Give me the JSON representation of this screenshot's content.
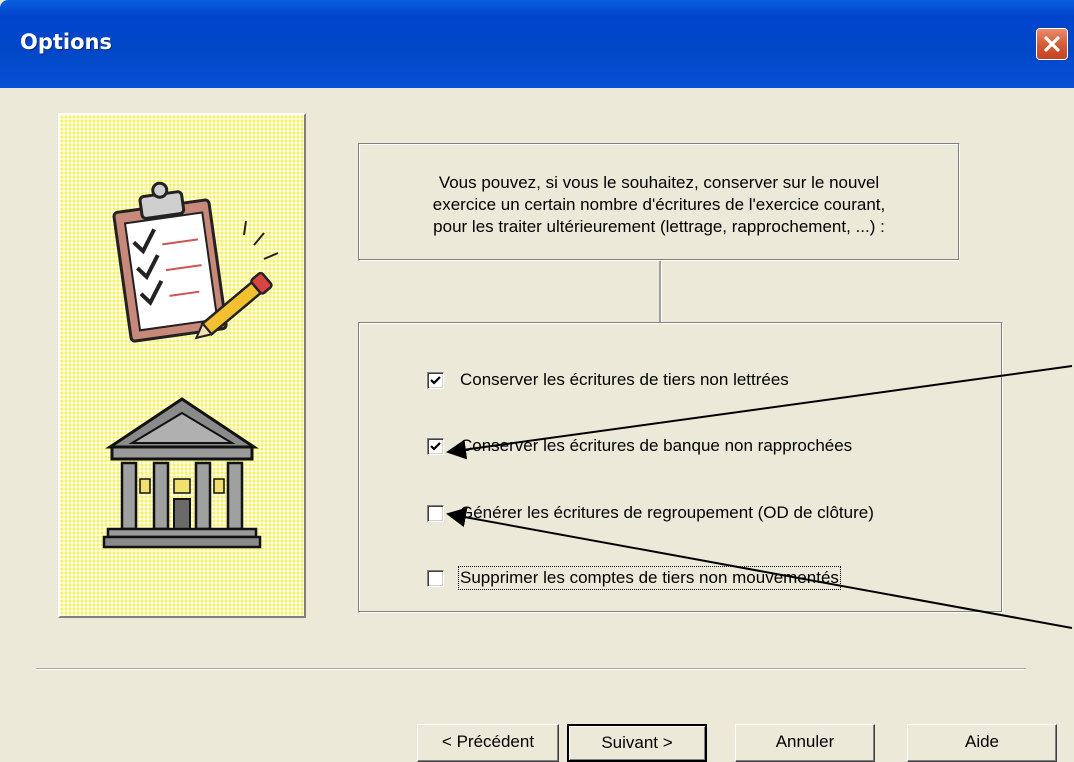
{
  "window": {
    "title": "Options"
  },
  "info": {
    "lines": [
      "Vous pouvez, si vous le souhaitez, conserver sur le nouvel",
      "exercice un certain nombre d'écritures de l'exercice courant,",
      "pour les traiter ultérieurement (lettrage, rapprochement, ...) :"
    ]
  },
  "options": [
    {
      "label": "Conserver les écritures de tiers non lettrées",
      "checked": true
    },
    {
      "label": "Conserver les écritures de banque non rapprochées",
      "checked": true
    },
    {
      "label": "Générer les écritures de regroupement (OD de clôture)",
      "checked": false
    },
    {
      "label": "Supprimer les comptes de tiers non mouvementés",
      "checked": false
    }
  ],
  "buttons": {
    "previous": "< Précédent",
    "next": "Suivant >",
    "cancel": "Annuler",
    "help": "Aide"
  },
  "icons": {
    "close": "close-icon",
    "checkmark": "checkmark-icon",
    "clipboard": "clipboard-checklist-icon",
    "bank": "bank-building-icon"
  },
  "colors": {
    "titlebar": "#0044cc",
    "dialog_bg": "#ece9d8",
    "close_button": "#d35a36",
    "illustration_bg": "#fcfaa8"
  }
}
